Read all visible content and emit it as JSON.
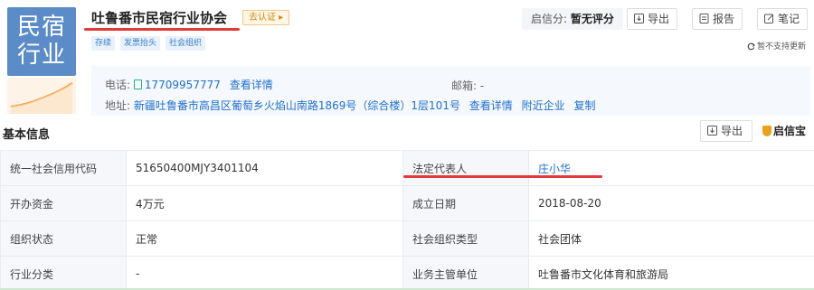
{
  "logo": {
    "text": "民宿行业",
    "icon": "trend-chart-icon"
  },
  "company": {
    "name": "吐鲁番市民宿行业协会",
    "cert_badge": "去认证 ▸",
    "tags": [
      "存续",
      "发票抬头",
      "社会组织"
    ]
  },
  "score": {
    "label": "启信分:",
    "value": "暂无评分"
  },
  "actions": {
    "export": "导出",
    "report": "报告",
    "note": "笔记"
  },
  "refresh_note": "暂不支持更新",
  "contact": {
    "phone_label": "电话:",
    "phone": "17709957777",
    "phone_detail": "查看详情",
    "email_label": "邮箱:",
    "email": "-",
    "address_label": "地址:",
    "address": "新疆吐鲁番市高昌区葡萄乡火焰山南路1869号（综合楼）1层101号",
    "address_detail": "查看详情",
    "nearby": "附近企业",
    "copy": "复制"
  },
  "basic": {
    "title": "基本信息",
    "export": "导出",
    "brand": "启信宝",
    "rows": [
      {
        "l1": "统一社会信用代码",
        "v1": "51650400MJY3401104",
        "l2": "法定代表人",
        "v2": "庄小华"
      },
      {
        "l1": "开办资金",
        "v1": "4万元",
        "l2": "成立日期",
        "v2": "2018-08-20"
      },
      {
        "l1": "组织状态",
        "v1": "正常",
        "l2": "社会组织类型",
        "v2": "社会团体"
      },
      {
        "l1": "行业分类",
        "v1": "-",
        "l2": "业务主管单位",
        "v2": "吐鲁番市文化体育和旅游局"
      }
    ]
  },
  "colors": {
    "brand_blue": "#5b8cc8",
    "link": "#1f6fce",
    "highlight_red": "#e03a3a",
    "tag_bg": "#e8f1fc"
  }
}
